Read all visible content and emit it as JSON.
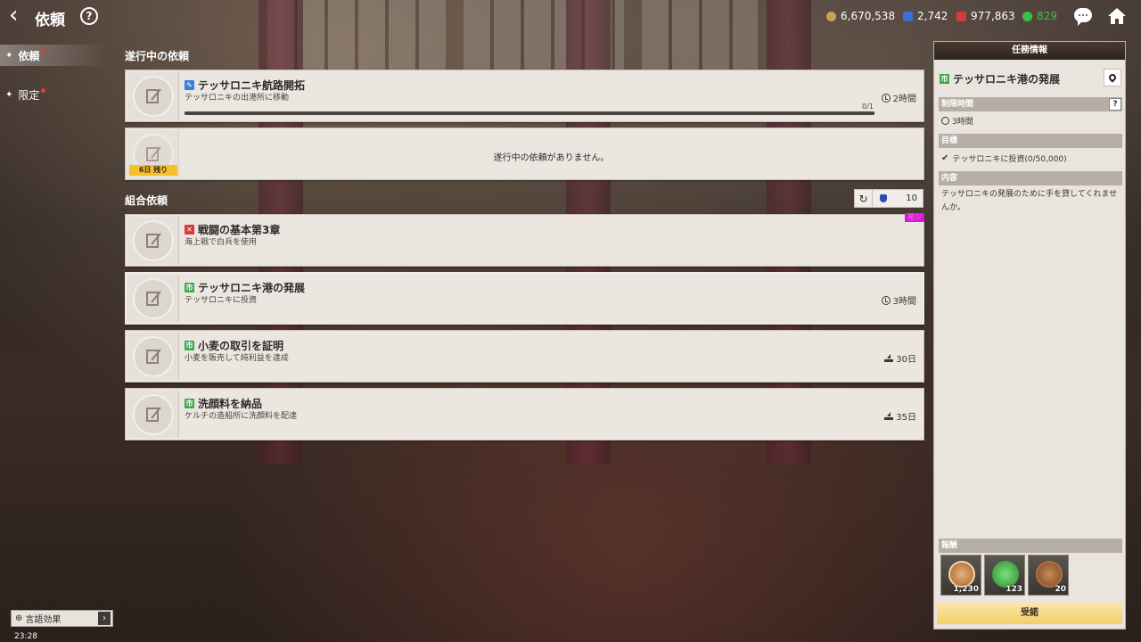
{
  "header": {
    "title": "依頼",
    "help": "?",
    "currencies": [
      {
        "value": "6,670,538",
        "color": "#c9a15a"
      },
      {
        "value": "2,742",
        "color": "#3a6fd8"
      },
      {
        "value": "977,863",
        "color": "#d83a3a"
      },
      {
        "value": "829",
        "color": "#39c24a"
      }
    ]
  },
  "sidebar": {
    "items": [
      {
        "label": "依頼",
        "active": true
      },
      {
        "label": "限定",
        "active": false
      }
    ]
  },
  "in_progress": {
    "heading": "遂行中の依頼",
    "cards": [
      {
        "title": "テッサロニキ航路開拓",
        "subtitle": "テッサロニキの出港所に移動",
        "time": "2時間",
        "progress_label": "0/1",
        "progress": 0.0
      }
    ],
    "empty": {
      "message": "遂行中の依頼がありません。",
      "days_badge": "6日 残り"
    }
  },
  "guild": {
    "heading": "組合依頼",
    "refresh_count": "10",
    "cards": [
      {
        "title": "戦闘の基本第3章",
        "subtitle": "海上戦で白兵を使用",
        "rare": "希少",
        "icon_color": "#d83a3a"
      },
      {
        "title": "テッサロニキ港の発展",
        "subtitle": "テッサロニキに投資",
        "time": "3時間",
        "icon_color": "#3ca84b"
      },
      {
        "title": "小麦の取引を証明",
        "subtitle": "小麦を販売して純利益を達成",
        "time": "30日",
        "icon_color": "#3ca84b"
      },
      {
        "title": "洗顔料を納品",
        "subtitle": "ケルチの造船所に洗顔料を配達",
        "time": "35日",
        "icon_color": "#3ca84b"
      }
    ]
  },
  "panel": {
    "header": "任務情報",
    "quest_title": "テッサロニキ港の発展",
    "time_limit_label": "制限時間",
    "time_limit_value": "3時間",
    "goal_label": "目標",
    "goal_value": "テッサロニキに投資(0/50,000)",
    "content_label": "内容",
    "content_value": "テッサロニキの発展のために手を貸してくれませんか。",
    "reward_label": "報酬",
    "rewards": [
      {
        "count": "1,230",
        "icon": "bronze-medal-icon"
      },
      {
        "count": "123",
        "icon": "green-star-icon"
      },
      {
        "count": "20",
        "icon": "compass-coin-icon"
      }
    ],
    "accept_label": "受諾",
    "help": "?"
  },
  "footer": {
    "language_effect": "言語効果",
    "arrow": "›",
    "clock": "23:28"
  }
}
